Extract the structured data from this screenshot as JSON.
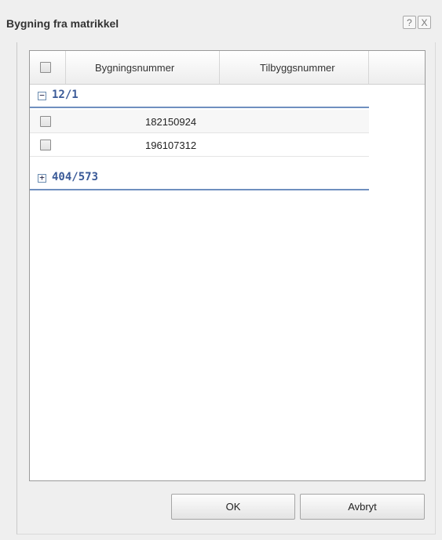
{
  "dialog": {
    "title": "Bygning fra matrikkel",
    "help_label": "?",
    "close_label": "X"
  },
  "grid": {
    "columns": [
      "Bygningsnummer",
      "Tilbyggsnummer"
    ],
    "groups": [
      {
        "label": "12/1",
        "expanded": true,
        "toggle_symbol": "−",
        "rows": [
          {
            "bygningsnummer": "182150924",
            "tilbyggsnummer": ""
          },
          {
            "bygningsnummer": "196107312",
            "tilbyggsnummer": ""
          }
        ]
      },
      {
        "label": "404/573",
        "expanded": false,
        "toggle_symbol": "+",
        "rows": []
      }
    ]
  },
  "buttons": {
    "ok_label": "OK",
    "cancel_label": "Avbryt"
  },
  "colors": {
    "group_text": "#3a5a98",
    "group_line": "#6f8fbf"
  }
}
